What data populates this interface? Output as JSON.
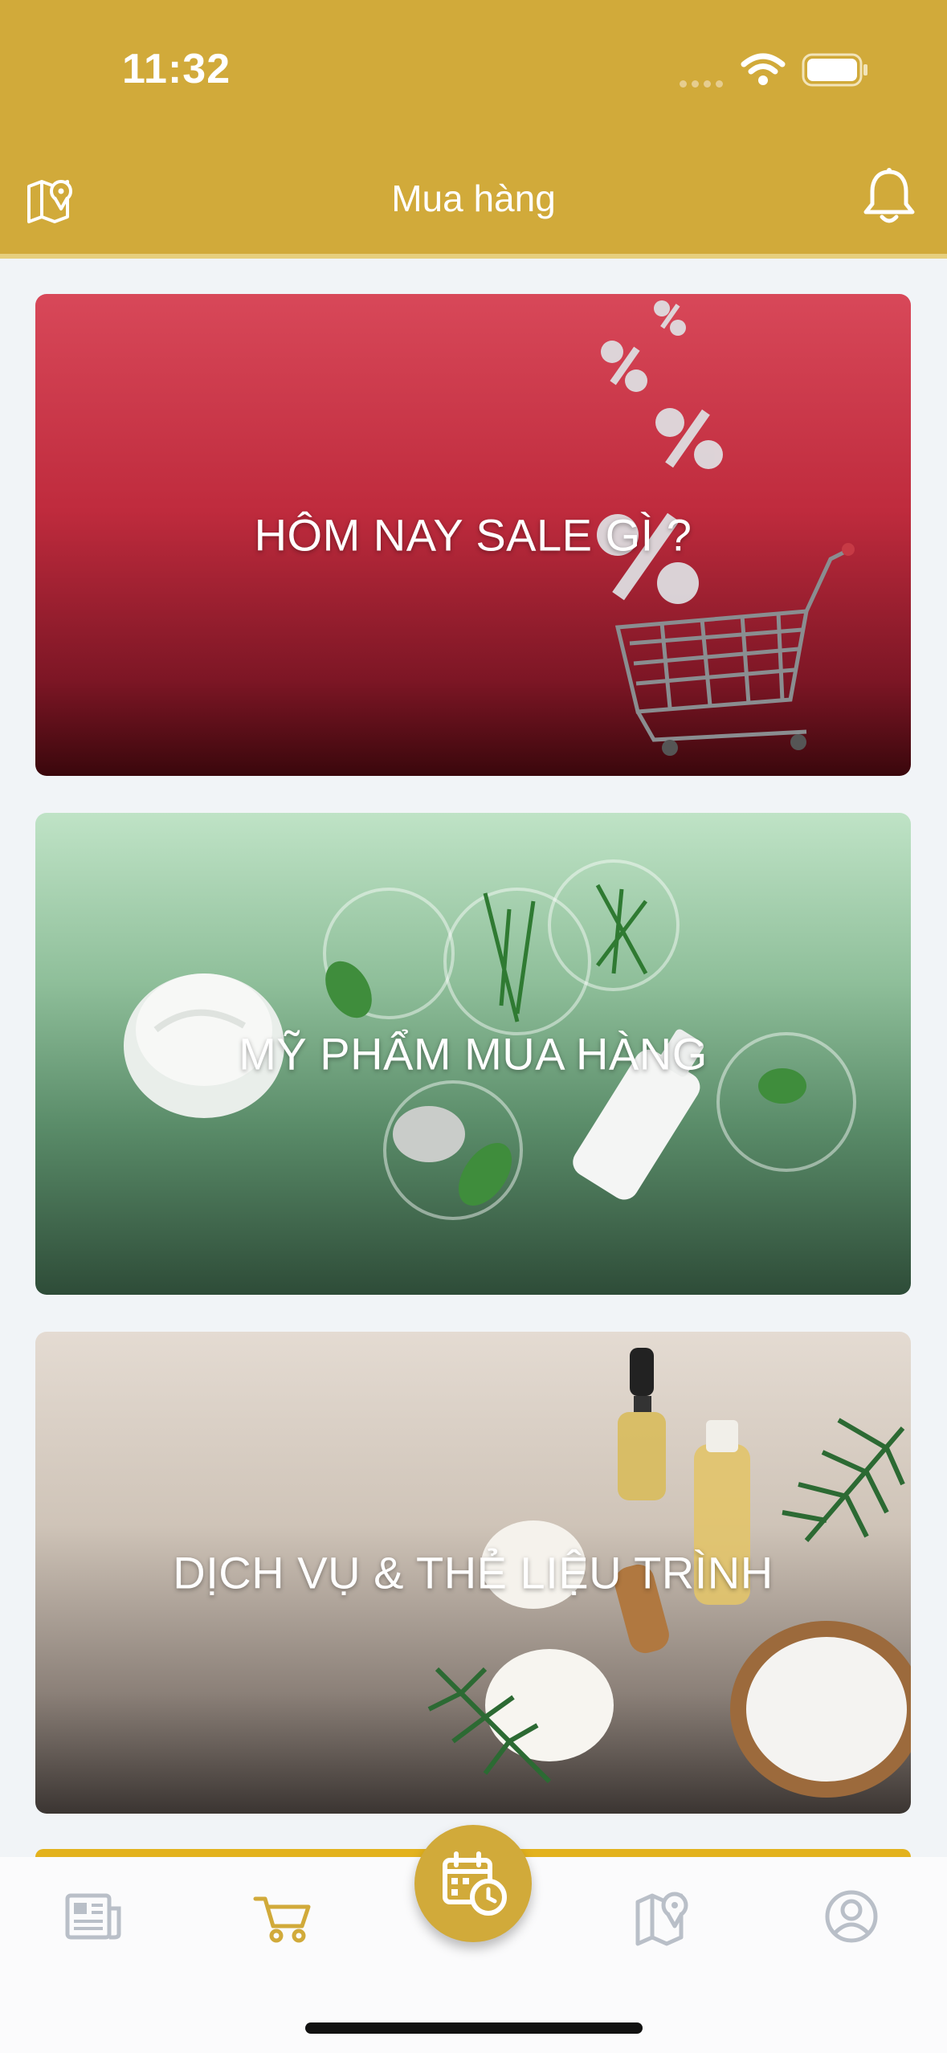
{
  "status_bar": {
    "time": "11:32"
  },
  "header": {
    "title": "Mua hàng"
  },
  "cards": [
    {
      "label": "HÔM NAY SALE GÌ ?"
    },
    {
      "label": "MỸ PHẨM MUA HÀNG"
    },
    {
      "label": "DỊCH VỤ & THẺ LIỆU TRÌNH"
    }
  ],
  "colors": {
    "brand": "#d1aa3a",
    "tab_inactive": "#b9bfc8"
  },
  "tabs": [
    {
      "icon": "news-icon",
      "active": false
    },
    {
      "icon": "cart-icon",
      "active": true
    },
    {
      "icon": "calendar-clock-icon",
      "active": false
    },
    {
      "icon": "map-icon",
      "active": false
    },
    {
      "icon": "profile-icon",
      "active": false
    }
  ]
}
